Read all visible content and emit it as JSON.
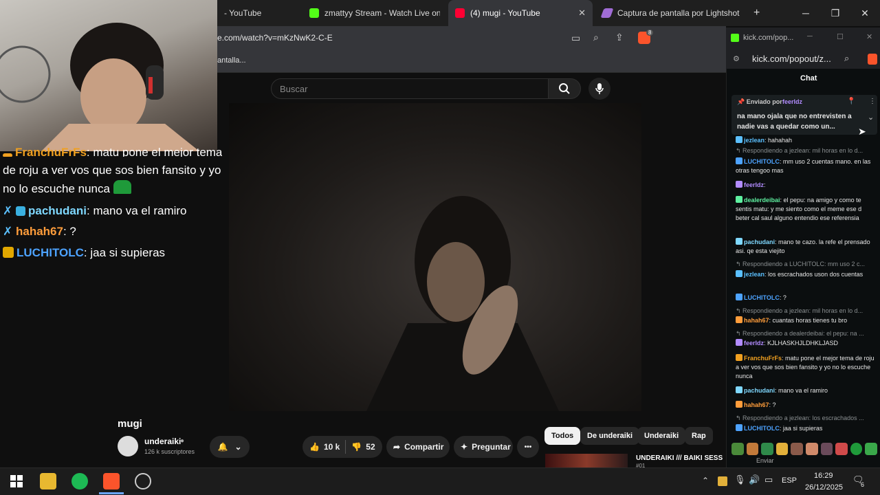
{
  "browser": {
    "tabs": [
      {
        "label": "- YouTube"
      },
      {
        "label": "zmattyy Stream - Watch Live on K"
      },
      {
        "label": "(4) mugi - YouTube"
      },
      {
        "label": "Captura de pantalla por Lightshot"
      }
    ],
    "new_tab_label": "+",
    "url": "e.com/watch?v=mKzNwK2-C-E",
    "bookmark": "antalla...",
    "shield_badge": "8"
  },
  "youtube": {
    "search_placeholder": "Buscar",
    "video_title": "mugi",
    "channel_name": "underaiki",
    "subscribers": "126 k suscriptores",
    "likes": "10 k",
    "dislikes": "52",
    "share_label": "Compartir",
    "ask_label": "Preguntar",
    "more_label": "•••",
    "chips": [
      "Todos",
      "De underaiki",
      "Underaiki",
      "Rap"
    ],
    "related_title": "UNDERAIKI /// BAIKI SESS",
    "related_sub": "#01"
  },
  "overlay_chat": [
    {
      "user": "FranchuFrFs",
      "text": ": matu pone el mejor tema",
      "color": "#f0a020"
    },
    {
      "user": "",
      "text": "de roju a ver vos que sos bien fansito y yo",
      "color": "#ffffff"
    },
    {
      "user": "",
      "text": "no lo escuche nunca",
      "color": "#ffffff"
    },
    {
      "user": "pachudani",
      "text": ": mano va el ramiro",
      "color": "#7fd8ff"
    },
    {
      "user": "hahah67",
      "text": ": ?",
      "color": "#ff9d3b"
    },
    {
      "user": "LUCHITOLC",
      "text": ": jaa si supieras",
      "color": "#4da3ff"
    }
  ],
  "kick": {
    "window_title": "kick.com/pop...",
    "url": "kick.com/popout/z...",
    "chat_header": "Chat",
    "pinned_label": "Enviado por",
    "pinned_user": "feerldz",
    "pinned_text": "na mano ojala que no entrevisten a nadie vas a quedar como un...",
    "messages": [
      {
        "type": "msg",
        "user": "jezlean",
        "text": ": hahahah",
        "color": "#5bc0ff"
      },
      {
        "type": "reply",
        "text": "Respondiendo a jezlean: mil horas en lo d..."
      },
      {
        "type": "msg",
        "user": "LUCHITOLC",
        "text": ": mm uso 2 cuentas mano. en las otras tengoo mas",
        "color": "#4da3ff"
      },
      {
        "type": "msg",
        "user": "feerldz",
        "text": ":",
        "color": "#b28cff"
      },
      {
        "type": "msg",
        "user": "dealerdeibai",
        "text": ": el pepu: na amigo y como te sentis matu: y me siento como el meme ese d beter cal saul alguno entendio ese referensia",
        "color": "#5ef0a0"
      },
      {
        "type": "msg",
        "user": "pachudani",
        "text": ": mano te cazo. la refe el prensado asi. qe esta viejito",
        "color": "#7fd8ff"
      },
      {
        "type": "reply",
        "text": "Respondiendo a LUCHITOLC: mm uso 2 c..."
      },
      {
        "type": "msg",
        "user": "jezlean",
        "text": ": los escrachados uson dos cuentas",
        "color": "#5bc0ff"
      },
      {
        "type": "msg",
        "user": "LUCHITOLC",
        "text": ": ?",
        "color": "#4da3ff"
      },
      {
        "type": "reply",
        "text": "Respondiendo a jezlean: mil horas en lo d..."
      },
      {
        "type": "msg",
        "user": "hahah67",
        "text": ": cuantas horas tienes tu bro",
        "color": "#ff9d3b"
      },
      {
        "type": "reply",
        "text": "Respondiendo a dealerdeibai: el pepu: na ..."
      },
      {
        "type": "msg",
        "user": "feerldz",
        "text": ": KJLHASKHJLDHKLJASD",
        "color": "#b28cff"
      },
      {
        "type": "msg",
        "user": "FranchuFrFs",
        "text": ": matu pone el mejor tema de roju a ver vos que sos bien fansito y yo no lo escuche nunca",
        "color": "#f0a020"
      },
      {
        "type": "msg",
        "user": "pachudani",
        "text": ": mano va el ramiro",
        "color": "#7fd8ff"
      },
      {
        "type": "msg",
        "user": "hahah67",
        "text": ": ?",
        "color": "#ff9d3b"
      },
      {
        "type": "reply",
        "text": "Respondiendo a jezlean: los escrachados ..."
      },
      {
        "type": "msg",
        "user": "LUCHITOLC",
        "text": ": jaa si supieras",
        "color": "#4da3ff"
      }
    ],
    "send_label": "Enviar"
  },
  "taskbar": {
    "lang": "ESP",
    "time": "16:29",
    "date": "26/12/2025",
    "notif_count": "6"
  }
}
